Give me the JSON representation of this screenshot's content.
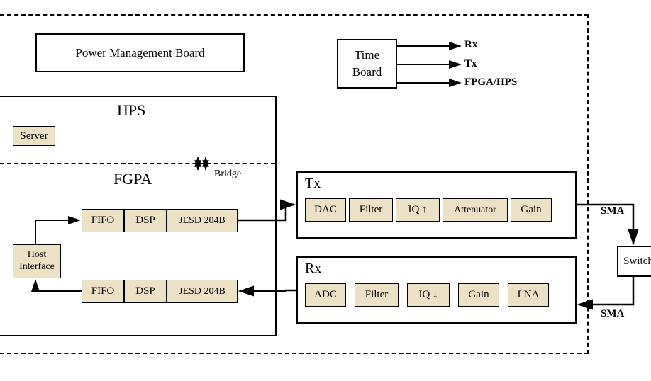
{
  "power_mgmt": "Power Management Board",
  "hps": {
    "title": "HPS",
    "server": "Server"
  },
  "fpga": {
    "title": "FGPA",
    "bridge": "Bridge",
    "host_interface_l1": "Host",
    "host_interface_l2": "Interface",
    "chain1": {
      "fifo": "FIFO",
      "dsp": "DSP",
      "jesd": "JESD 204B"
    },
    "chain2": {
      "fifo": "FIFO",
      "dsp": "DSP",
      "jesd": "JESD 204B"
    }
  },
  "time_board": {
    "l1": "Time",
    "l2": "Board",
    "out_rx": "Rx",
    "out_tx": "Tx",
    "out_fpga": "FPGA/HPS"
  },
  "tx": {
    "title": "Tx",
    "dac": "DAC",
    "filter": "Filter",
    "iq": "IQ ↑",
    "att": "Attenuator",
    "gain": "Gain"
  },
  "rx": {
    "title": "Rx",
    "adc": "ADC",
    "filter": "Filter",
    "iq": "IQ ↓",
    "gain": "Gain",
    "lna": "LNA"
  },
  "switch": "Switch",
  "sma1": "SMA",
  "sma2": "SMA"
}
